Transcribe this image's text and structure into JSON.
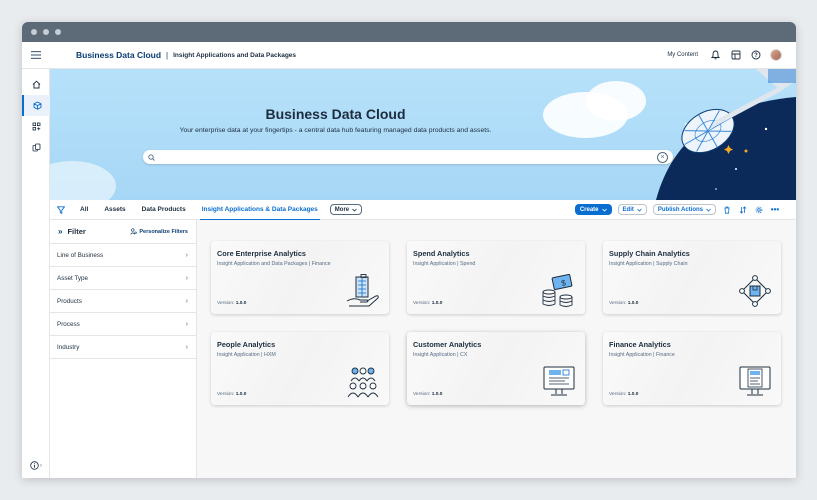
{
  "shell": {
    "brand": "Business Data Cloud",
    "separator": "|",
    "subtitle": "Insight Applications and Data Packages",
    "my_content": "My Content"
  },
  "hero": {
    "title": "Business Data Cloud",
    "subtitle": "Your enterprise data at your fingertips - a central data hub featuring managed data products and assets.",
    "search_value": "",
    "search_placeholder": ""
  },
  "tabs": [
    {
      "label": "All"
    },
    {
      "label": "Assets"
    },
    {
      "label": "Data Products"
    },
    {
      "label": "Insight Applications & Data Packages",
      "active": true
    }
  ],
  "more_label": "More",
  "actions": {
    "create": "Create",
    "edit": "Edit",
    "publish": "Publish Actions"
  },
  "filter": {
    "title": "Filter",
    "personalize": "Personalize Filters",
    "items": [
      "Line of Business",
      "Asset Type",
      "Products",
      "Process",
      "Industry"
    ]
  },
  "cards": [
    {
      "title": "Core Enterprise Analytics",
      "subtitle": "Insight Application and Data Packages  |  Finance",
      "version_label": "Version:",
      "version": "1.0.0",
      "icon": "building-hand-icon"
    },
    {
      "title": "Spend Analytics",
      "subtitle": "Insight Application  |  Spend",
      "version_label": "Version:",
      "version": "1.0.0",
      "icon": "money-coins-icon"
    },
    {
      "title": "Supply Chain Analytics",
      "subtitle": "Insight Application  |  Supply Chain",
      "version_label": "Version:",
      "version": "1.0.0",
      "icon": "network-box-icon"
    },
    {
      "title": "People Analytics",
      "subtitle": "Insight Application  |  HXM",
      "version_label": "Version:",
      "version": "1.0.0",
      "icon": "people-group-icon"
    },
    {
      "title": "Customer Analytics",
      "subtitle": "Insight Application  |  CX",
      "version_label": "Version:",
      "version": "1.0.0",
      "icon": "monitor-dashboard-icon"
    },
    {
      "title": "Finance Analytics",
      "subtitle": "Insight Application  |  Finance",
      "version_label": "Version:",
      "version": "1.0.0",
      "icon": "monitor-report-icon"
    }
  ],
  "colors": {
    "brand_blue": "#0a6ed1",
    "brand_dark": "#0a3d73",
    "hero_bg": "#b7e1fa",
    "navy": "#0b2a5a",
    "accent_orange": "#f5a623"
  }
}
